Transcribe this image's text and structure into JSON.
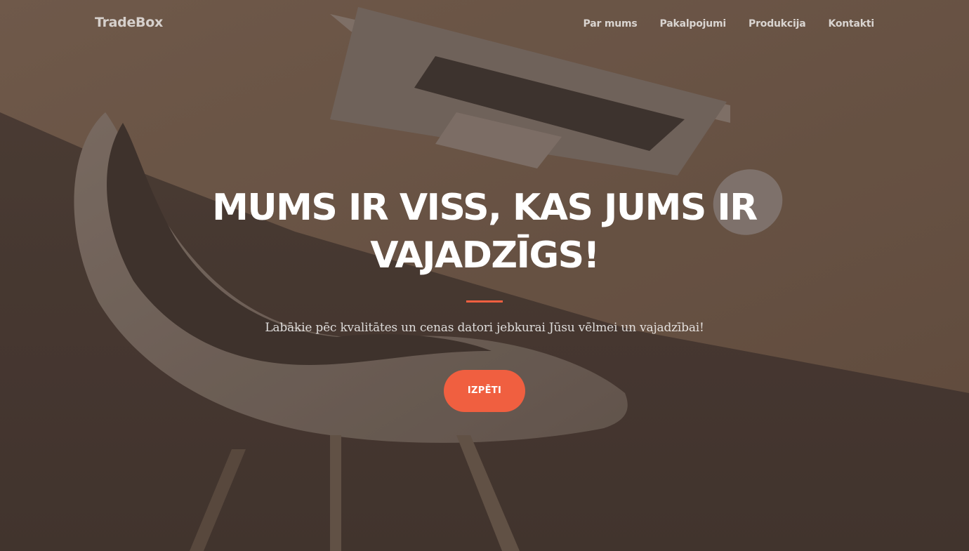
{
  "navbar": {
    "brand": "TradeBox",
    "links": [
      {
        "label": "Par mums"
      },
      {
        "label": "Pakalpojumi"
      },
      {
        "label": "Produkcija"
      },
      {
        "label": "Kontakti"
      }
    ]
  },
  "hero": {
    "headline": "MUMS IR VISS, KAS JUMS IR VAJADZĪGS!",
    "subtitle": "Labākie pēc kvalitātes un cenas datori jebkurai Jūsu vēlmei un vajadzībai!",
    "cta_label": "IZPĒTI"
  },
  "colors": {
    "accent": "#f05f40",
    "overlay": "#4b3d35",
    "text": "#ffffff"
  }
}
